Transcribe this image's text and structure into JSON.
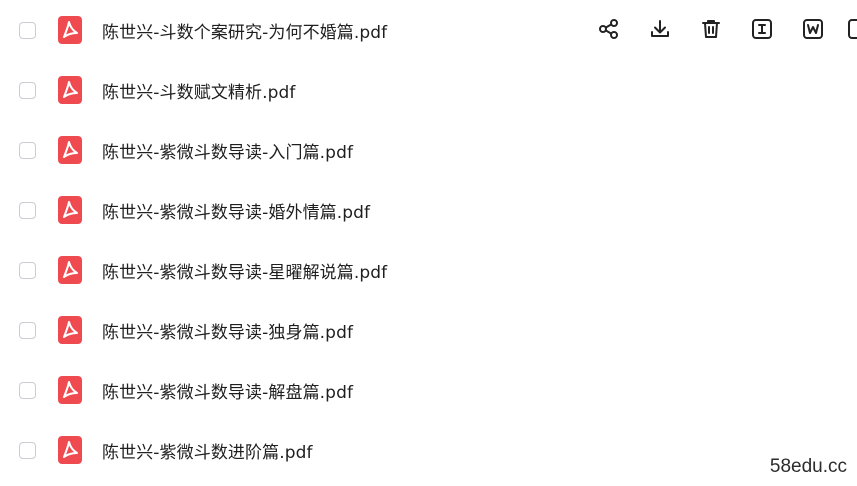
{
  "files": [
    {
      "name": "陈世兴-斗数个案研究-为何不婚篇.pdf"
    },
    {
      "name": "陈世兴-斗数赋文精析.pdf"
    },
    {
      "name": "陈世兴-紫微斗数导读-入门篇.pdf"
    },
    {
      "name": "陈世兴-紫微斗数导读-婚外情篇.pdf"
    },
    {
      "name": "陈世兴-紫微斗数导读-星曜解说篇.pdf"
    },
    {
      "name": "陈世兴-紫微斗数导读-独身篇.pdf"
    },
    {
      "name": "陈世兴-紫微斗数导读-解盘篇.pdf"
    },
    {
      "name": "陈世兴-紫微斗数进阶篇.pdf"
    }
  ],
  "row_actions": [
    {
      "icon": "share-icon"
    },
    {
      "icon": "download-icon"
    },
    {
      "icon": "delete-icon"
    },
    {
      "icon": "text-extract-icon"
    },
    {
      "icon": "word-convert-icon"
    },
    {
      "icon": "more-icon"
    }
  ],
  "colors": {
    "pdf_icon": "#ef4a50",
    "text": "#1f1f1f",
    "checkbox_border": "#c9cdd4",
    "action_icon": "#222222"
  },
  "watermark": "58edu.cc"
}
